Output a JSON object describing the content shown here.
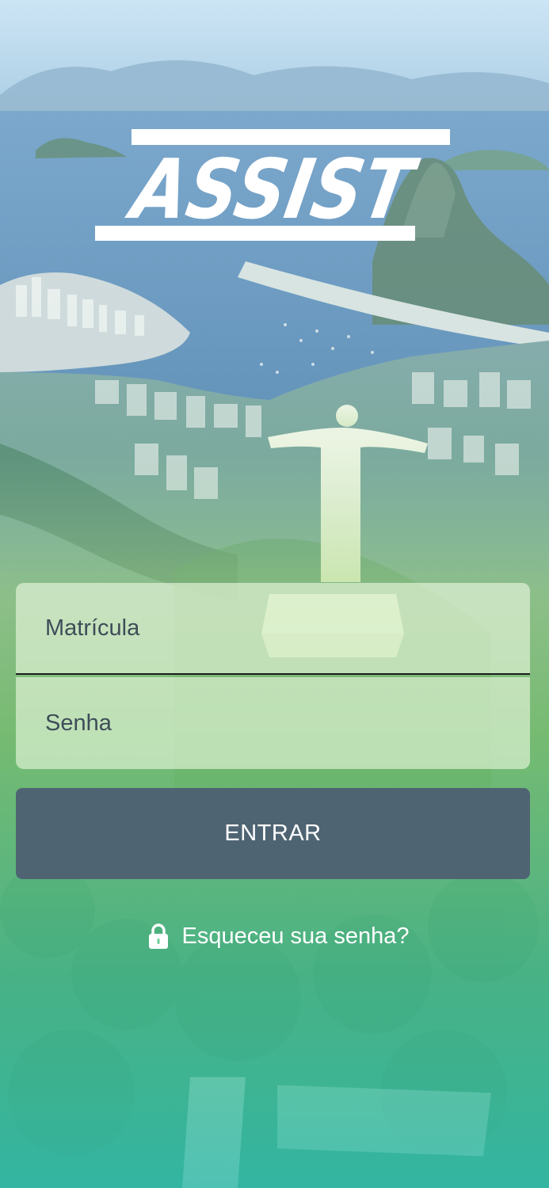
{
  "brand": {
    "logo_text": "ASSIST"
  },
  "login_form": {
    "username_placeholder": "Matrícula",
    "username_value": "",
    "password_placeholder": "Senha",
    "password_value": "",
    "submit_label": "ENTRAR"
  },
  "forgot_password": {
    "label": "Esqueceu sua senha?",
    "icon": "lock-icon"
  },
  "colors": {
    "button_bg": "#4f6473",
    "field_bg": "#ecf8e0",
    "gradient_top": "#bcd7ec",
    "gradient_bottom": "#3bbfae"
  }
}
